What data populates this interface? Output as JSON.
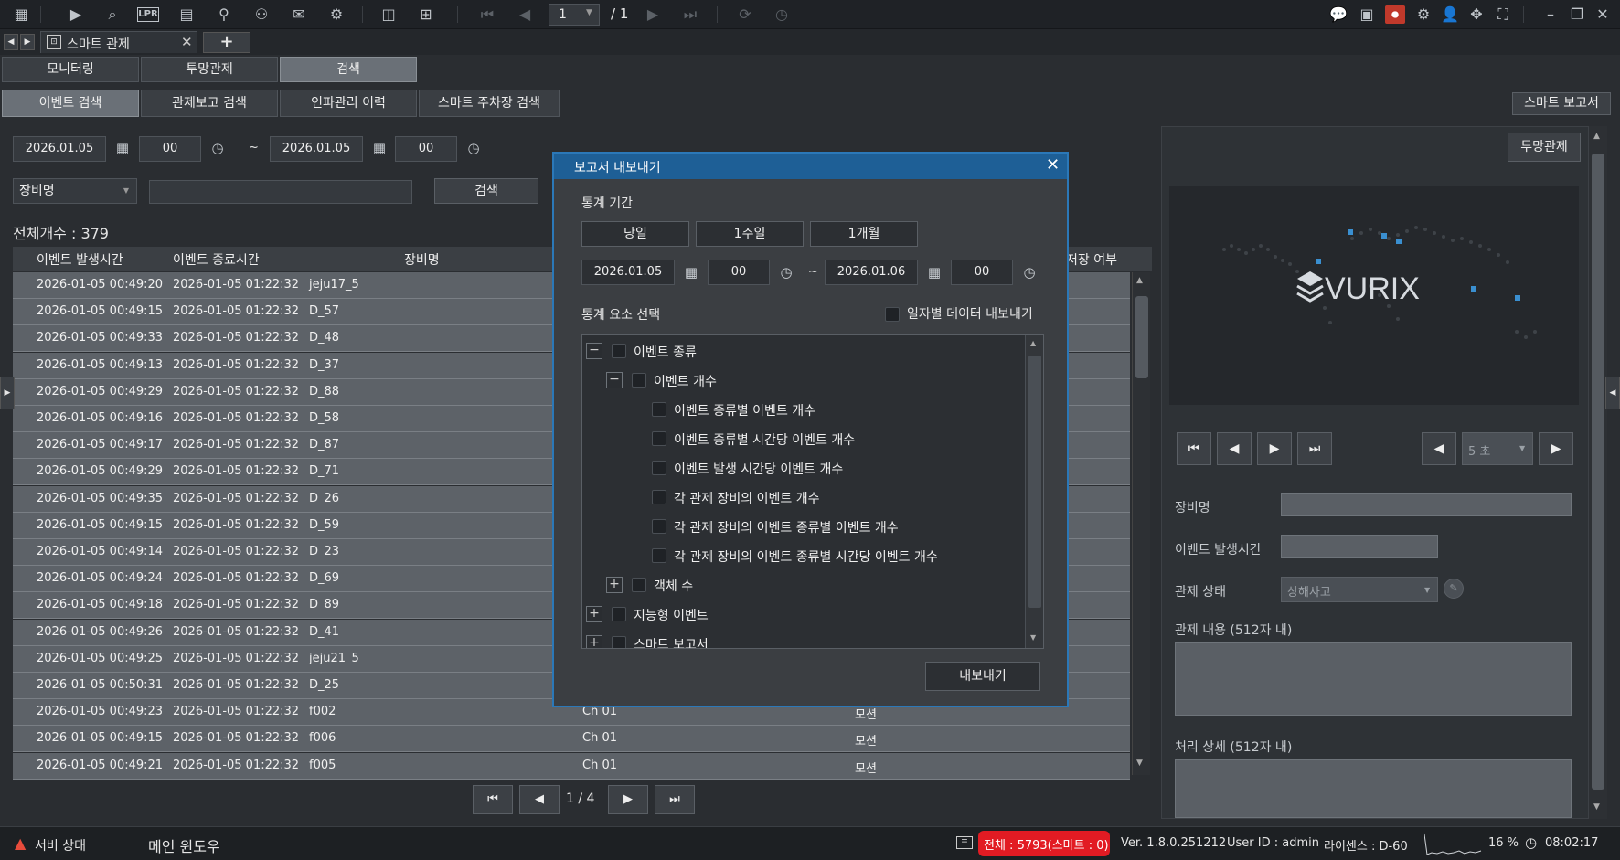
{
  "toolbar": {
    "page_current": "1",
    "page_total": "/ 1",
    "lpr_label": "LPR"
  },
  "tabs": {
    "main_tab": "스마트 관제",
    "add_tab": "+"
  },
  "nav_tabs": [
    "모니터링",
    "투망관제",
    "검색"
  ],
  "sub_tabs": [
    "이벤트 검색",
    "관제보고 검색",
    "인파관리 이력",
    "스마트 주차장 검색"
  ],
  "smart_report_button": "스마트 보고서",
  "search": {
    "start_date": "2026.01.05",
    "start_hour": "00",
    "tilde": "~",
    "end_date": "2026.01.05",
    "end_hour": "00",
    "device_select": "장비명",
    "search_button": "검색"
  },
  "total_count": "전체개수 : 379",
  "table": {
    "headers": [
      "이벤트 발생시간",
      "이벤트 종료시간",
      "장비명",
      "저장 여부"
    ],
    "rows": [
      [
        "2026-01-05 00:49:20",
        "2026-01-05 01:22:32",
        "jeju17_5",
        "",
        ""
      ],
      [
        "2026-01-05 00:49:15",
        "2026-01-05 01:22:32",
        "D_57",
        "",
        ""
      ],
      [
        "2026-01-05 00:49:33",
        "2026-01-05 01:22:32",
        "D_48",
        "",
        ""
      ],
      [
        "2026-01-05 00:49:13",
        "2026-01-05 01:22:32",
        "D_37",
        "",
        ""
      ],
      [
        "2026-01-05 00:49:29",
        "2026-01-05 01:22:32",
        "D_88",
        "",
        ""
      ],
      [
        "2026-01-05 00:49:16",
        "2026-01-05 01:22:32",
        "D_58",
        "",
        ""
      ],
      [
        "2026-01-05 00:49:17",
        "2026-01-05 01:22:32",
        "D_87",
        "",
        ""
      ],
      [
        "2026-01-05 00:49:29",
        "2026-01-05 01:22:32",
        "D_71",
        "",
        ""
      ],
      [
        "2026-01-05 00:49:35",
        "2026-01-05 01:22:32",
        "D_26",
        "",
        ""
      ],
      [
        "2026-01-05 00:49:15",
        "2026-01-05 01:22:32",
        "D_59",
        "",
        ""
      ],
      [
        "2026-01-05 00:49:14",
        "2026-01-05 01:22:32",
        "D_23",
        "",
        ""
      ],
      [
        "2026-01-05 00:49:24",
        "2026-01-05 01:22:32",
        "D_69",
        "",
        ""
      ],
      [
        "2026-01-05 00:49:18",
        "2026-01-05 01:22:32",
        "D_89",
        "",
        ""
      ],
      [
        "2026-01-05 00:49:26",
        "2026-01-05 01:22:32",
        "D_41",
        "",
        ""
      ],
      [
        "2026-01-05 00:49:25",
        "2026-01-05 01:22:32",
        "jeju21_5",
        "",
        ""
      ],
      [
        "2026-01-05 00:50:31",
        "2026-01-05 01:22:32",
        "D_25",
        "",
        ""
      ],
      [
        "2026-01-05 00:49:23",
        "2026-01-05 01:22:32",
        "f002",
        "Ch 01",
        "모션"
      ],
      [
        "2026-01-05 00:49:15",
        "2026-01-05 01:22:32",
        "f006",
        "Ch 01",
        "모션"
      ],
      [
        "2026-01-05 00:49:21",
        "2026-01-05 01:22:32",
        "f005",
        "Ch 01",
        "모션"
      ]
    ]
  },
  "pagination": {
    "label": "1  /  4"
  },
  "right_panel": {
    "top_button": "투망관제",
    "logo_text": "VURIX",
    "speed_select": "5 초",
    "device_label": "장비명",
    "event_time_label": "이벤트 발생시간",
    "status_label": "관제 상태",
    "status_value": "상해사고",
    "content_label": "관제 내용 (512자 내)",
    "detail_label": "처리 상세 (512자 내)"
  },
  "dialog": {
    "title": "보고서 내보내기",
    "period_label": "통계 기간",
    "period_buttons": [
      "당일",
      "1주일",
      "1개월"
    ],
    "start_date": "2026.01.05",
    "start_hour": "00",
    "tilde": "~",
    "end_date": "2026.01.06",
    "end_hour": "00",
    "element_label": "통계 요소 선택",
    "daily_export_label": "일자별 데이터 내보내기",
    "tree": {
      "event_type": "이벤트 종류",
      "event_count": "이벤트 개수",
      "items": [
        "이벤트 종류별 이벤트 개수",
        "이벤트 종류별 시간당 이벤트 개수",
        "이벤트 발생 시간당 이벤트 개수",
        "각 관제 장비의 이벤트 개수",
        "각 관제 장비의 이벤트 종류별 이벤트 개수",
        "각 관제 장비의 이벤트 종류별 시간당 이벤트 개수"
      ],
      "object_count": "객체 수",
      "smart_event": "지능형 이벤트",
      "smart_report": "스마트 보고서"
    },
    "export_button": "내보내기"
  },
  "status_bar": {
    "server_status": "서버 상태",
    "main_window": "메인 윈도우",
    "total": "전체 : 5793(스마트 : 0)",
    "version": "Ver. 1.8.0.251212",
    "user": "User ID : admin",
    "license": "라이센스 : D-60",
    "cpu": "16 %",
    "time": "08:02:17"
  }
}
